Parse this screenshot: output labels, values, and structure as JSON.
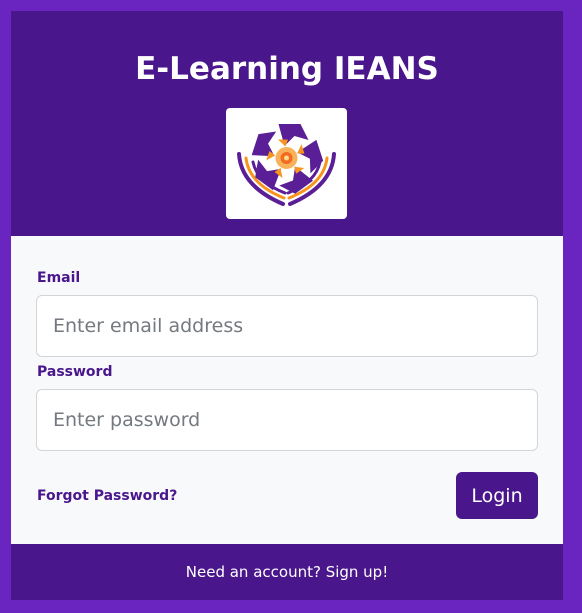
{
  "header": {
    "title": "E-Learning IEANS",
    "logo_icon": "ieans-logo-icon"
  },
  "form": {
    "email": {
      "label": "Email",
      "value": "",
      "placeholder": "Enter email address"
    },
    "password": {
      "label": "Password",
      "value": "",
      "placeholder": "Enter password"
    },
    "forgot_label": "Forgot Password?",
    "login_label": "Login"
  },
  "footer": {
    "signup_label": "Need an account? Sign up!"
  },
  "colors": {
    "page_background": "#6a25c0",
    "primary": "#4a168c",
    "card_background": "#f8f9fb",
    "logo_accent": "#f7941d"
  }
}
